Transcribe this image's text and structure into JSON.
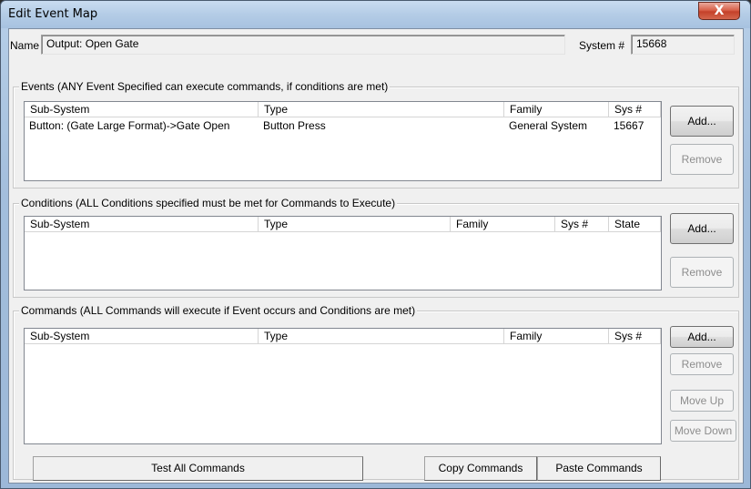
{
  "window": {
    "title": "Edit Event Map",
    "close_label": "X"
  },
  "name_field": {
    "label": "Name",
    "value": "Output: Open Gate"
  },
  "system_field": {
    "label": "System #",
    "value": "15668"
  },
  "events": {
    "title": "Events (ANY Event Specified can execute commands, if conditions are met)",
    "columns": [
      "Sub-System",
      "Type",
      "Family",
      "Sys #"
    ],
    "rows": [
      {
        "subsystem": "Button: (Gate Large Format)->Gate Open",
        "type": "Button Press",
        "family": "General System",
        "sys": "15667"
      }
    ],
    "add_label": "Add...",
    "remove_label": "Remove"
  },
  "conditions": {
    "title": "Conditions (ALL Conditions specified must be met for Commands to Execute)",
    "columns": [
      "Sub-System",
      "Type",
      "Family",
      "Sys #",
      "State"
    ],
    "add_label": "Add...",
    "remove_label": "Remove"
  },
  "commands": {
    "title": "Commands (ALL Commands will execute if Event occurs and Conditions are met)",
    "columns": [
      "Sub-System",
      "Type",
      "Family",
      "Sys #"
    ],
    "add_label": "Add...",
    "remove_label": "Remove",
    "move_up_label": "Move Up",
    "move_down_label": "Move Down"
  },
  "footer": {
    "test_all_label": "Test All Commands",
    "copy_label": "Copy Commands",
    "paste_label": "Paste Commands"
  }
}
